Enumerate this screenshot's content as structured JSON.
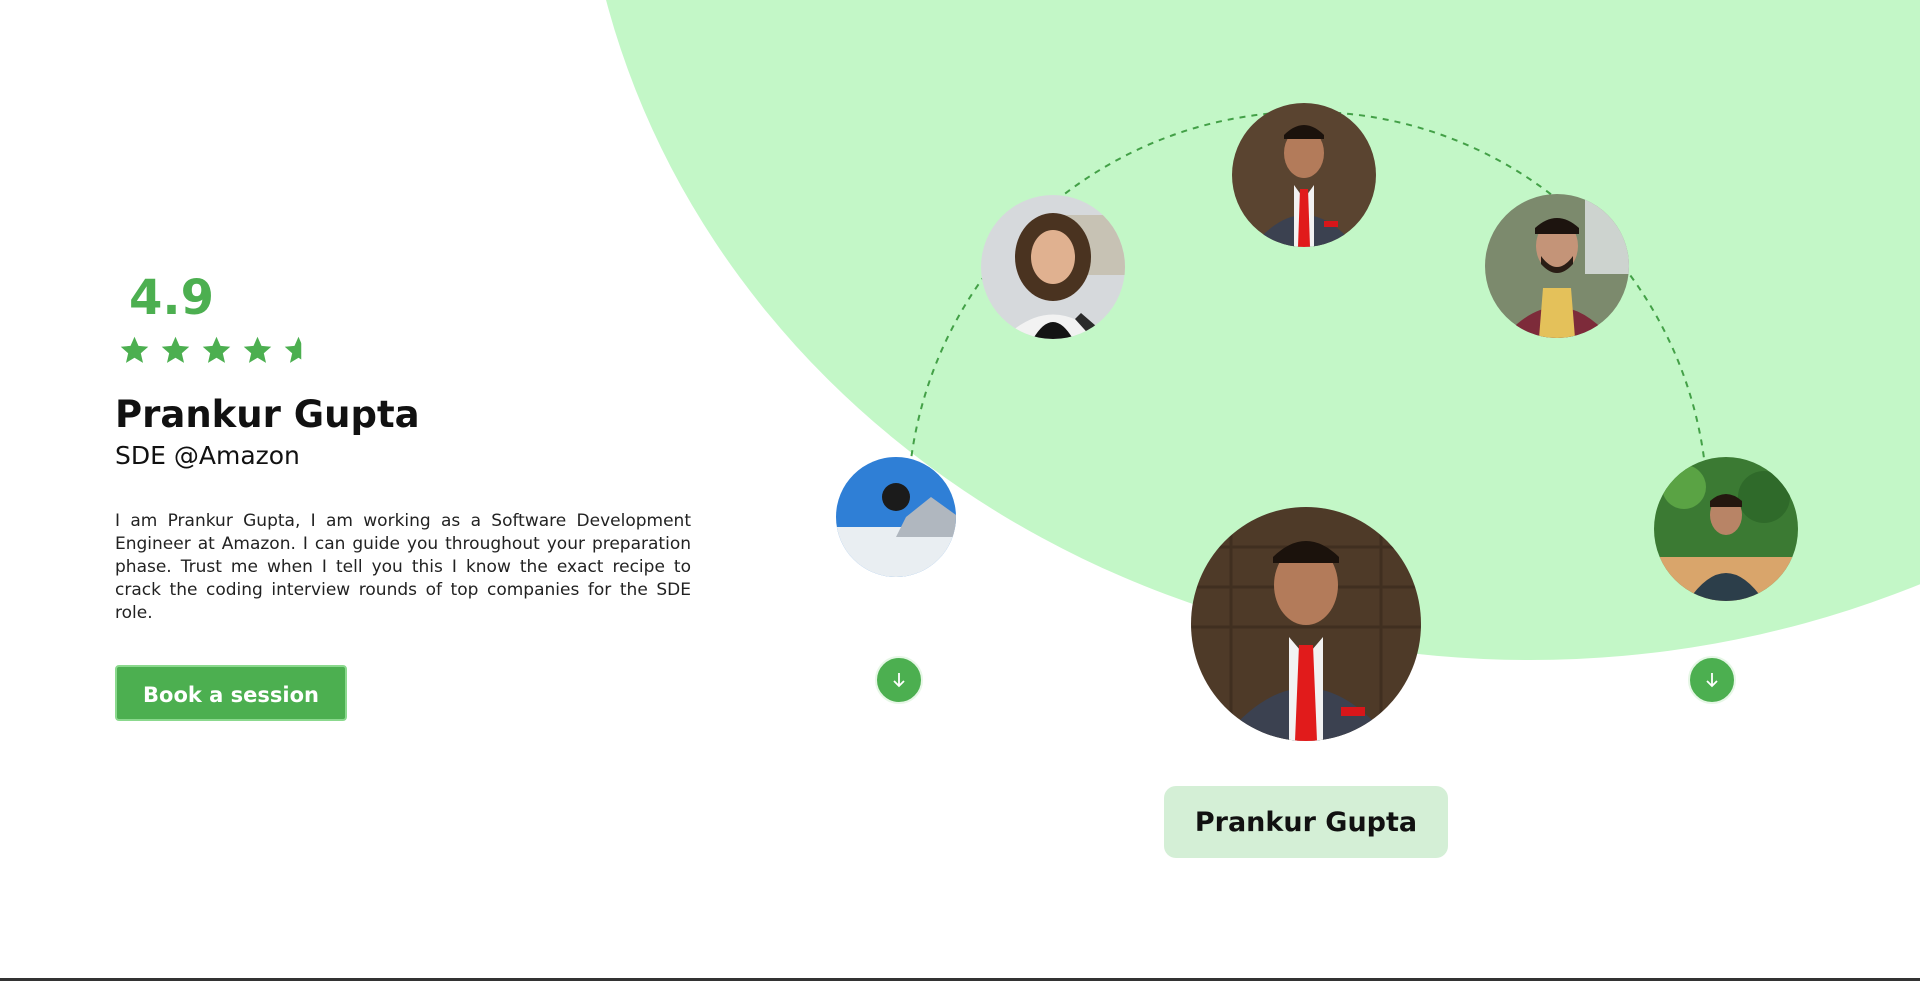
{
  "profile": {
    "rating": "4.9",
    "stars_filled": 4.5,
    "stars_total": 5,
    "name": "Prankur Gupta",
    "role": "SDE @Amazon",
    "bio": "I am Prankur Gupta, I am working as a Software Development Engineer at Amazon. I can guide you throughout your preparation phase. Trust me when I tell you this I know the exact recipe to crack the coding interview rounds of top companies for the SDE role.",
    "book_button_label": "Book a session"
  },
  "carousel": {
    "selected_name": "Prankur Gupta",
    "left_arrow_icon": "arrow-down-icon",
    "right_arrow_icon": "arrow-down-icon"
  },
  "colors": {
    "accent": "#4caf50",
    "background_circle": "#c3f7c7",
    "name_card_bg": "#d4efd6",
    "text_dark": "#111111"
  }
}
